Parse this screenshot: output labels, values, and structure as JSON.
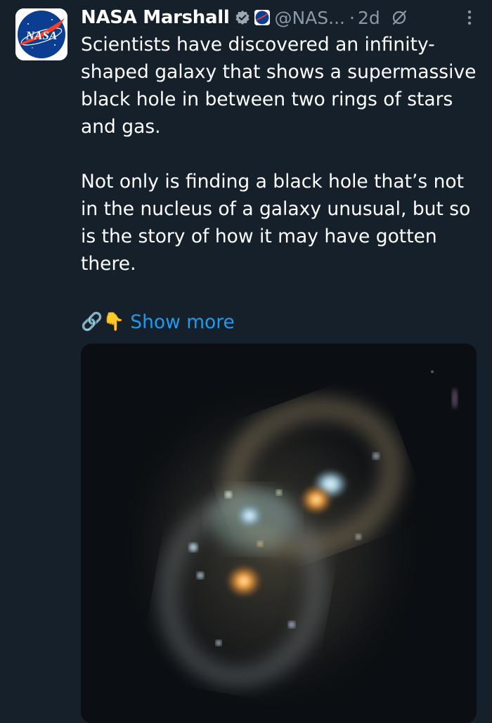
{
  "post": {
    "author": {
      "display_name": "NASA Marshall",
      "handle": "@NAS...",
      "avatar_text": "NASA",
      "verified_badge_icon": "verified-badge-icon",
      "affiliate_icon": "nasa-affiliate-icon"
    },
    "separator": "·",
    "time": "2d",
    "grok_icon": "grok-icon",
    "more_icon": "more-vertical-icon",
    "paragraphs": [
      "Scientists have discovered an infinity-shaped galaxy that shows a supermassive black hole in between two rings of stars and gas.",
      "Not only is finding a black hole that’s not in the nucleus of a galaxy unusual, but so is the story of how it may have gotten there."
    ],
    "link_emoji": "🔗👇",
    "show_more_label": "Show more",
    "media_icon": "galaxy-image"
  },
  "colors": {
    "background": "#15202b",
    "text": "#ffffff",
    "muted": "#8b98a5",
    "link": "#1d9bf0"
  }
}
